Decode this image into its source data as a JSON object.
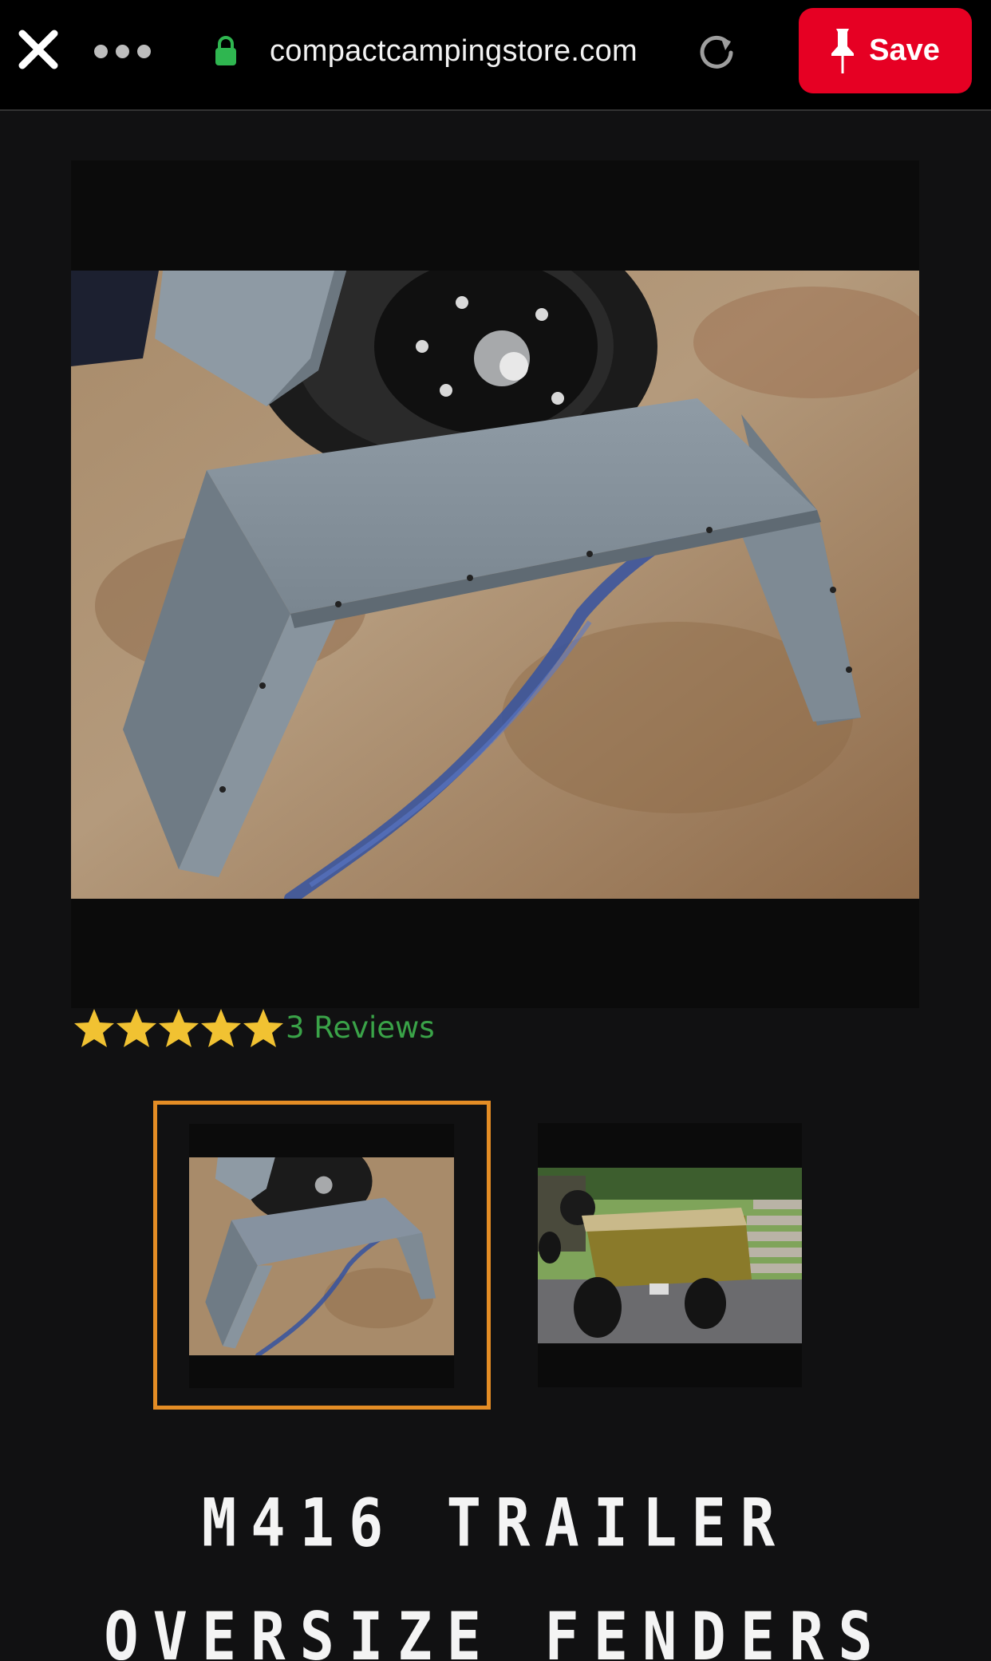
{
  "browser": {
    "url": "compactcampingstore.com",
    "close_icon": "close-icon",
    "more_icon": "more-dots-icon",
    "lock_icon": "lock-icon",
    "reload_icon": "reload-icon",
    "save_label": "Save",
    "save_icon": "pin-icon",
    "accent_color": "#e60023",
    "lock_color": "#2fb650"
  },
  "product": {
    "rating_stars": 5,
    "reviews_label": "3 Reviews",
    "star_color": "#f1c232",
    "reviews_color": "#3aa348",
    "title": "M416 TRAILER OVERSIZE FENDERS",
    "thumbnails": [
      {
        "subject": "gray trailer fender on concrete floor",
        "selected": true
      },
      {
        "subject": "yellow off-road trailer behind jeep",
        "selected": false
      }
    ],
    "selected_border_color": "#e48d25"
  }
}
